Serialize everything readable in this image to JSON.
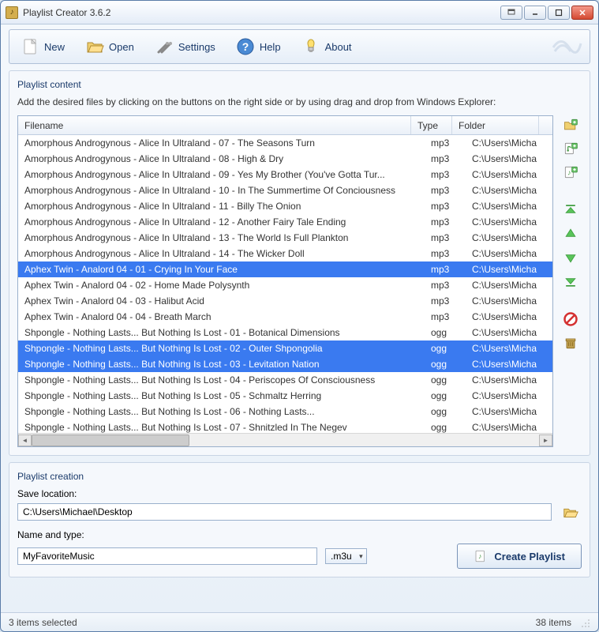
{
  "window": {
    "title": "Playlist Creator 3.6.2"
  },
  "toolbar": {
    "new": "New",
    "open": "Open",
    "settings": "Settings",
    "help": "Help",
    "about": "About"
  },
  "playlist_content": {
    "group_title": "Playlist content",
    "instruction": "Add the desired files by clicking on the buttons on the right side or by using drag and drop from Windows Explorer:",
    "columns": {
      "filename": "Filename",
      "type": "Type",
      "folder": "Folder"
    },
    "rows": [
      {
        "filename": "Amorphous Androgynous - Alice In Ultraland - 07 - The Seasons Turn",
        "type": "mp3",
        "folder": "C:\\Users\\Micha",
        "selected": false
      },
      {
        "filename": "Amorphous Androgynous - Alice In Ultraland - 08 - High & Dry",
        "type": "mp3",
        "folder": "C:\\Users\\Micha",
        "selected": false
      },
      {
        "filename": "Amorphous Androgynous - Alice In Ultraland - 09 - Yes My Brother (You've Gotta Tur...",
        "type": "mp3",
        "folder": "C:\\Users\\Micha",
        "selected": false
      },
      {
        "filename": "Amorphous Androgynous - Alice In Ultraland - 10 - In The Summertime Of Conciousness",
        "type": "mp3",
        "folder": "C:\\Users\\Micha",
        "selected": false
      },
      {
        "filename": "Amorphous Androgynous - Alice In Ultraland - 11 - Billy The Onion",
        "type": "mp3",
        "folder": "C:\\Users\\Micha",
        "selected": false
      },
      {
        "filename": "Amorphous Androgynous - Alice In Ultraland - 12 - Another Fairy Tale Ending",
        "type": "mp3",
        "folder": "C:\\Users\\Micha",
        "selected": false
      },
      {
        "filename": "Amorphous Androgynous - Alice In Ultraland - 13 - The World Is Full Plankton",
        "type": "mp3",
        "folder": "C:\\Users\\Micha",
        "selected": false
      },
      {
        "filename": "Amorphous Androgynous - Alice In Ultraland - 14 - The Wicker Doll",
        "type": "mp3",
        "folder": "C:\\Users\\Micha",
        "selected": false
      },
      {
        "filename": "Aphex Twin - Analord 04 - 01 - Crying In Your Face",
        "type": "mp3",
        "folder": "C:\\Users\\Micha",
        "selected": true
      },
      {
        "filename": "Aphex Twin - Analord 04 - 02 - Home Made Polysynth",
        "type": "mp3",
        "folder": "C:\\Users\\Micha",
        "selected": false
      },
      {
        "filename": "Aphex Twin - Analord 04 - 03 - Halibut Acid",
        "type": "mp3",
        "folder": "C:\\Users\\Micha",
        "selected": false
      },
      {
        "filename": "Aphex Twin - Analord 04 - 04 - Breath March",
        "type": "mp3",
        "folder": "C:\\Users\\Micha",
        "selected": false
      },
      {
        "filename": "Shpongle - Nothing Lasts... But Nothing Is Lost - 01 - Botanical Dimensions",
        "type": "ogg",
        "folder": "C:\\Users\\Micha",
        "selected": false
      },
      {
        "filename": "Shpongle - Nothing Lasts... But Nothing Is Lost - 02 - Outer Shpongolia",
        "type": "ogg",
        "folder": "C:\\Users\\Micha",
        "selected": true
      },
      {
        "filename": "Shpongle - Nothing Lasts... But Nothing Is Lost - 03 - Levitation Nation",
        "type": "ogg",
        "folder": "C:\\Users\\Micha",
        "selected": true
      },
      {
        "filename": "Shpongle - Nothing Lasts... But Nothing Is Lost - 04 - Periscopes Of Consciousness",
        "type": "ogg",
        "folder": "C:\\Users\\Micha",
        "selected": false
      },
      {
        "filename": "Shpongle - Nothing Lasts... But Nothing Is Lost - 05 - Schmaltz Herring",
        "type": "ogg",
        "folder": "C:\\Users\\Micha",
        "selected": false
      },
      {
        "filename": "Shpongle - Nothing Lasts... But Nothing Is Lost - 06 - Nothing Lasts...",
        "type": "ogg",
        "folder": "C:\\Users\\Micha",
        "selected": false
      },
      {
        "filename": "Shpongle - Nothing Lasts... But Nothing Is Lost - 07 - Shnitzled In The Negev",
        "type": "ogg",
        "folder": "C:\\Users\\Micha",
        "selected": false
      }
    ]
  },
  "playlist_creation": {
    "group_title": "Playlist creation",
    "save_location_label": "Save location:",
    "save_location_value": "C:\\Users\\Michael\\Desktop",
    "name_label": "Name and type:",
    "name_value": "MyFavoriteMusic",
    "ext_selected": ".m3u",
    "create_label": "Create Playlist"
  },
  "status": {
    "left": "3 items selected",
    "right": "38 items"
  }
}
